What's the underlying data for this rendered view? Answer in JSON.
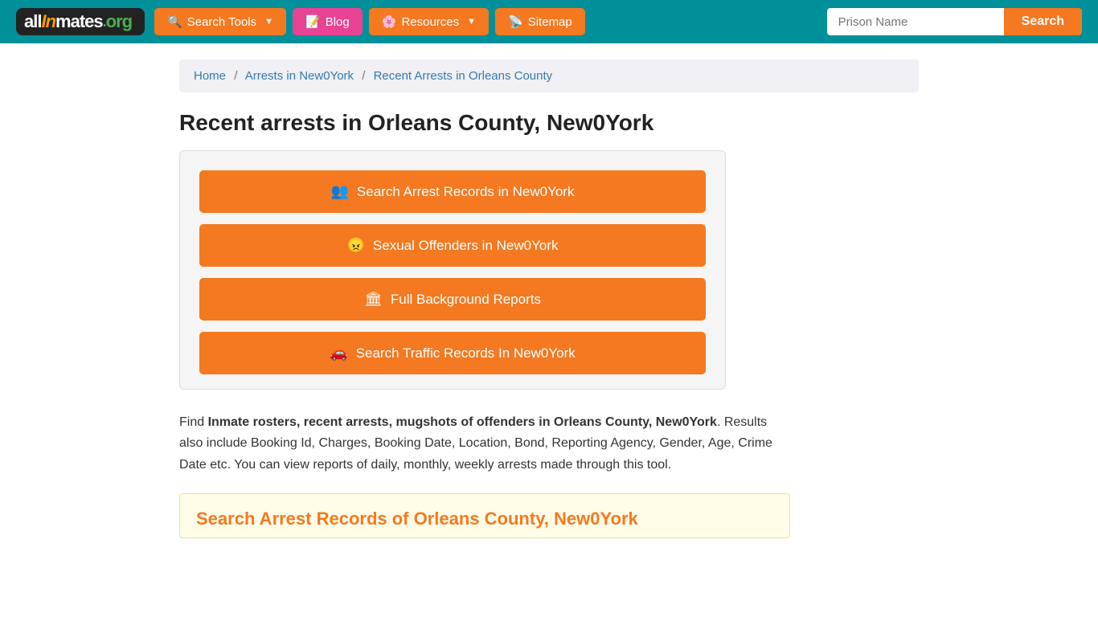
{
  "header": {
    "logo": {
      "text_all": "all",
      "text_inmates": "Inmates",
      "text_org": ".org"
    },
    "nav": [
      {
        "label": "Search Tools",
        "icon": "🔍",
        "has_dropdown": true,
        "class": "orange"
      },
      {
        "label": "Blog",
        "icon": "📝",
        "has_dropdown": false,
        "class": "blog"
      },
      {
        "label": "Resources",
        "icon": "🌸",
        "has_dropdown": true,
        "class": "orange"
      },
      {
        "label": "Sitemap",
        "icon": "📡",
        "has_dropdown": false,
        "class": "orange"
      }
    ],
    "search_placeholder": "Prison Name",
    "search_button": "Search"
  },
  "breadcrumb": {
    "home": "Home",
    "arrests": "Arrests in New0York",
    "current": "Recent Arrests in Orleans County"
  },
  "page": {
    "title": "Recent arrests in Orleans County, New0York",
    "buttons": [
      {
        "label": "Search Arrest Records in New0York",
        "icon": "👥"
      },
      {
        "label": "Sexual Offenders in New0York",
        "icon": "😠"
      },
      {
        "label": "Full Background Reports",
        "icon": "🏛"
      },
      {
        "label": "Search Traffic Records In New0York",
        "icon": "🚗"
      }
    ],
    "description_intro": "Find ",
    "description_bold": "Inmate rosters, recent arrests, mugshots of offenders in Orleans County, New0York",
    "description_rest": ". Results also include Booking Id, Charges, Booking Date, Location, Bond, Reporting Agency, Gender, Age, Crime Date etc. You can view reports of daily, monthly, weekly arrests made through this tool.",
    "yellow_heading": "Search Arrest Records of Orleans County, New0York"
  }
}
